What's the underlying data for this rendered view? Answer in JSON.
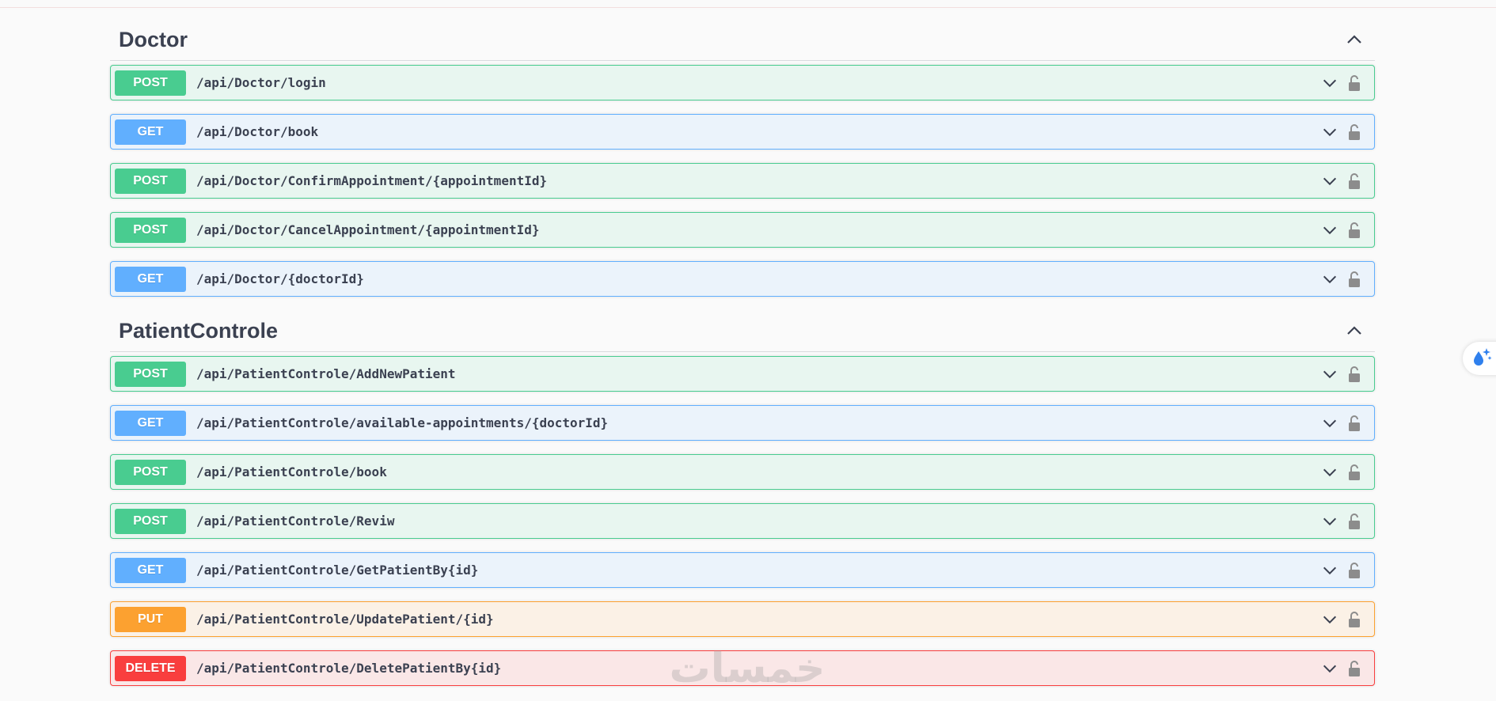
{
  "sections": [
    {
      "title": "Doctor",
      "operations": [
        {
          "method": "POST",
          "path": "/api/Doctor/login"
        },
        {
          "method": "GET",
          "path": "/api/Doctor/book"
        },
        {
          "method": "POST",
          "path": "/api/Doctor/ConfirmAppointment/{appointmentId}"
        },
        {
          "method": "POST",
          "path": "/api/Doctor/CancelAppointment/{appointmentId}"
        },
        {
          "method": "GET",
          "path": "/api/Doctor/{doctorId}"
        }
      ]
    },
    {
      "title": "PatientControle",
      "operations": [
        {
          "method": "POST",
          "path": "/api/PatientControle/AddNewPatient"
        },
        {
          "method": "GET",
          "path": "/api/PatientControle/available-appointments/{doctorId}"
        },
        {
          "method": "POST",
          "path": "/api/PatientControle/book"
        },
        {
          "method": "POST",
          "path": "/api/PatientControle/Reviw"
        },
        {
          "method": "GET",
          "path": "/api/PatientControle/GetPatientBy{id}"
        },
        {
          "method": "PUT",
          "path": "/api/PatientControle/UpdatePatient/{id}"
        },
        {
          "method": "DELETE",
          "path": "/api/PatientControle/DeletePatientBy{id}"
        }
      ]
    }
  ],
  "watermark": "خمسات",
  "colors": {
    "post": "#49cc90",
    "get": "#61affe",
    "put": "#fca130",
    "delete": "#f93e3e",
    "text": "#3b4151",
    "icon": "#8c8c8c"
  },
  "icons": {
    "section_toggle": "chevron-up-icon",
    "operation_toggle": "chevron-down-icon",
    "auth": "unlocked-padlock-icon",
    "side_widget": "sparkle-drop-icon"
  }
}
